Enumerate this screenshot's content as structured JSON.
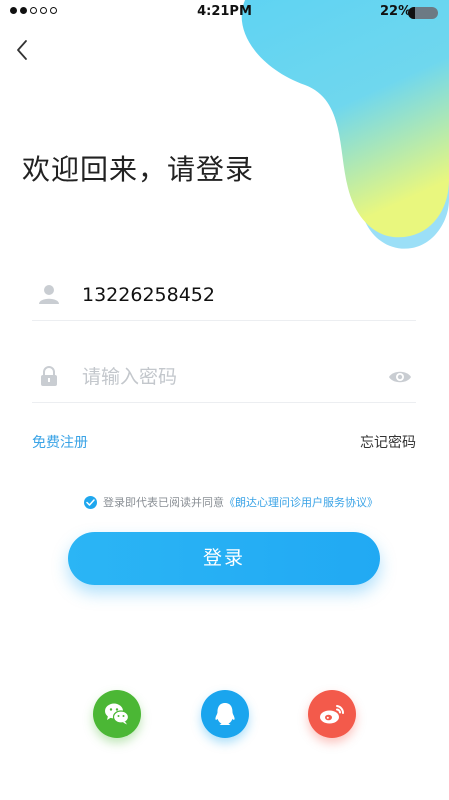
{
  "status_bar": {
    "time": "4:21PM",
    "battery_percent": "22%",
    "battery_level": 0.22,
    "signal_bars_filled": 2,
    "signal_bars_total": 5
  },
  "header": {
    "back_icon": "chevron-left-icon"
  },
  "title": "欢迎回来，请登录",
  "form": {
    "phone_value": "13226258452",
    "password_placeholder": "请输入密码",
    "register_label": "免费注册",
    "forgot_label": "忘记密码"
  },
  "agreement": {
    "checked": true,
    "text": "登录即代表已阅读并同意",
    "link": "《朗达心理问诊用户服务协议》"
  },
  "login_button": "登录",
  "social": [
    {
      "icon": "wechat-icon",
      "color": "#4bb735"
    },
    {
      "icon": "qq-icon",
      "color": "#1aa5ee"
    },
    {
      "icon": "weibo-icon",
      "color": "#f35a4b"
    }
  ],
  "colors": {
    "accent": "#21a9f3",
    "link": "#3aa3e6"
  }
}
